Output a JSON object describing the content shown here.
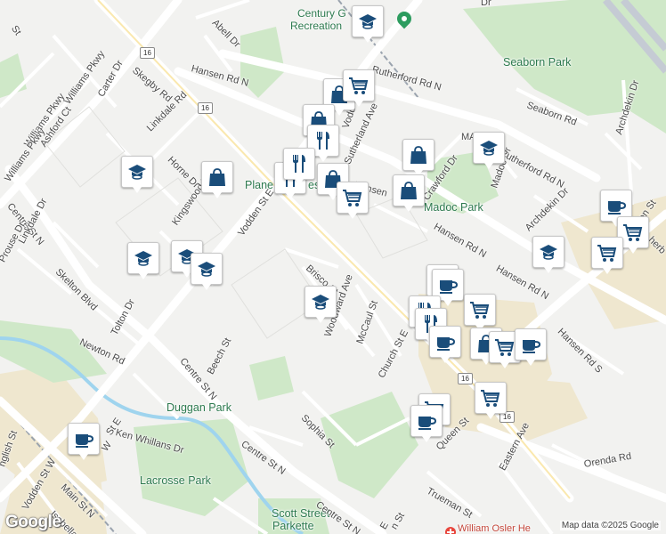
{
  "map": {
    "attribution": "Map data ©2025 Google",
    "logo_text": "Google",
    "hospital_label": "William Osler He",
    "parks": {
      "seaborn": "Seaborn Park",
      "madoc": "Madoc Park",
      "duggan": "Duggan Park",
      "lacrosse": "Lacrosse Park",
      "scott_1": "Scott Street",
      "scott_2": "Parkette",
      "planet": "Plane",
      "planet_tail": "es",
      "century_1": "Century G",
      "century_2": "Recreation"
    },
    "streets": {
      "abell": "Abell Dr",
      "st_top": "St",
      "dr_top": "Dr",
      "hansen_top": "Hansen Rd N",
      "rutherford_top": "Rutherford Rd N",
      "seaborn_rd": "Seaborn Rd",
      "archdekin": "Archdekin Dr",
      "williams_1": "Williams Pkwy",
      "williams_2": "Williams Pkwy",
      "williams_3": "Williams Pkwy",
      "skegby": "Skegby Rd",
      "carter": "Carter Dr",
      "ashford": "Ashford Ct",
      "linkdale": "Linkdale Rd",
      "linkdale_dr": "Linkdale Dr",
      "horne": "Horne Dr",
      "kingswood": "Kingswood D",
      "vodden_e": "Vodden St E",
      "vodden_top": "Vodd",
      "sutherland": "Sutherland Ave",
      "crawford": "Crawford Dr",
      "madoc_dr": "Madoc Dr",
      "ma": "MA",
      "rutherford_right": "Rutherford Rd N",
      "queen_right": "Queen St",
      "herb": "herb",
      "hansen_mid": "Hansen",
      "hansen_n_1": "Hansen Rd N",
      "hansen_n_2": "Hansen Rd N",
      "archdekin_mid": "Archdekin Dr",
      "hansen_s": "Hansen Rd S",
      "centre_nw": "Centre St N",
      "prouse": "Prouse Dr",
      "skelton": "Skelton Blvd",
      "brisco": "Brisco St",
      "woodward": "Woodward Ave",
      "mccaul": "McCaul St",
      "tolton": "Tolton Dr",
      "newton": "Newton Rd",
      "beech": "Beech St",
      "centre_mid": "Centre St N",
      "church": "Church St E",
      "sophia": "Sophia St",
      "ken_whillans": "Ken Whillans Dr",
      "centre_low": "Centre St N",
      "centre_bottom": "Centre St N",
      "e_bottom": "E",
      "n_st": "n St",
      "vodden_w": "Vodden St W",
      "main_n": "Main St N",
      "isabella": "Isabella St",
      "english": "nglish St",
      "w_st": "W",
      "st_e": "St E",
      "queen_mid": "Queen St",
      "be": "Be",
      "eastern": "Eastern Ave",
      "trueman": "Trueman St",
      "orenda": "Orenda Rd"
    },
    "highway_shields": [
      "16",
      "16",
      "16",
      "16"
    ],
    "poi_markers": [
      {
        "icon": "school"
      },
      {
        "icon": "shopping-bag"
      },
      {
        "icon": "grocery-cart"
      },
      {
        "icon": "shopping-bag"
      },
      {
        "icon": "restaurant"
      },
      {
        "icon": "restaurant"
      },
      {
        "icon": "restaurant"
      },
      {
        "icon": "shopping-bag"
      },
      {
        "icon": "grocery-cart"
      },
      {
        "icon": "shopping-bag"
      },
      {
        "icon": "shopping-bag"
      },
      {
        "icon": "school"
      },
      {
        "icon": "school"
      },
      {
        "icon": "shopping-bag"
      },
      {
        "icon": "school"
      },
      {
        "icon": "school"
      },
      {
        "icon": "school"
      },
      {
        "icon": "school"
      },
      {
        "icon": "coffee"
      },
      {
        "icon": "grocery-cart"
      },
      {
        "icon": "grocery-cart"
      },
      {
        "icon": "school"
      },
      {
        "icon": "coffee"
      },
      {
        "icon": "coffee"
      },
      {
        "icon": "grocery-cart"
      },
      {
        "icon": "restaurant"
      },
      {
        "icon": "restaurant"
      },
      {
        "icon": "coffee"
      },
      {
        "icon": "shopping-bag"
      },
      {
        "icon": "grocery-cart"
      },
      {
        "icon": "coffee"
      },
      {
        "icon": "grocery-cart"
      },
      {
        "icon": "grocery-cart"
      },
      {
        "icon": "coffee"
      },
      {
        "icon": "coffee"
      }
    ],
    "colors": {
      "background": "#f2f2f0",
      "road": "#ffffff",
      "highway": "#c5cbd4",
      "park": "#c8e6c9",
      "water": "#aadaff",
      "commercial": "#f5ecd0",
      "icon": "#1a4d7a"
    }
  }
}
